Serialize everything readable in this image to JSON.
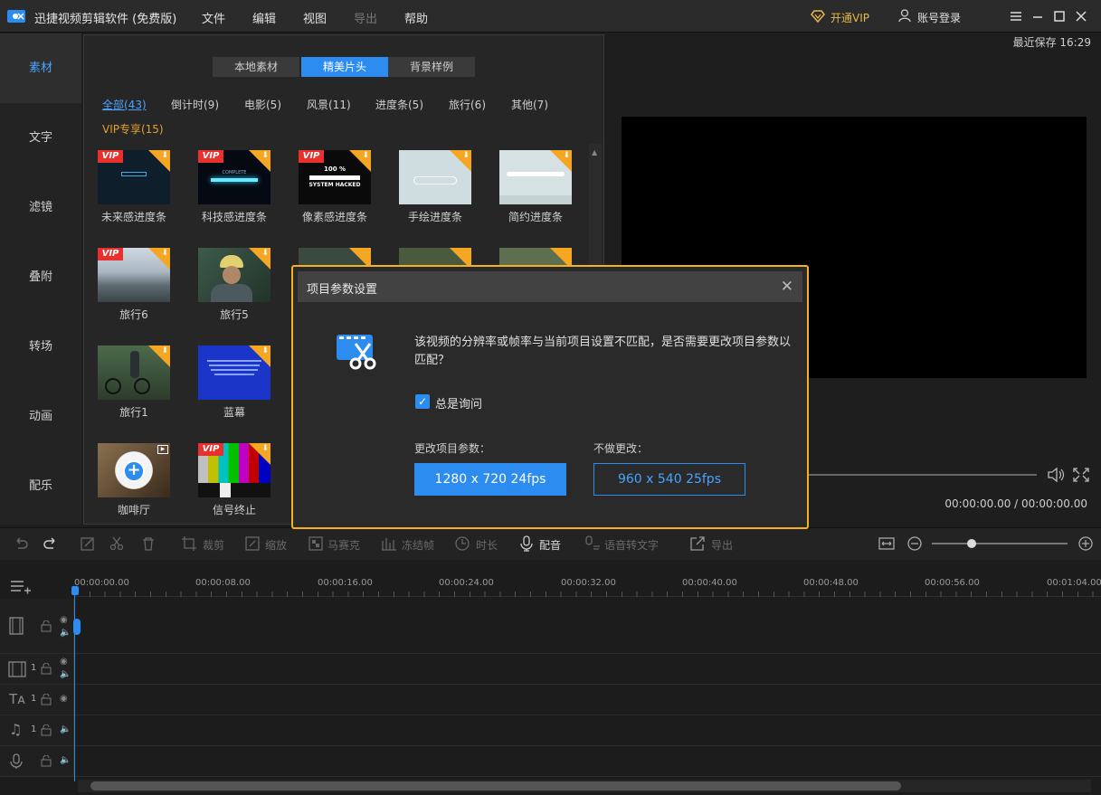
{
  "app": {
    "title": "迅捷视频剪辑软件 (免费版)"
  },
  "menu": {
    "file": "文件",
    "edit": "编辑",
    "view": "视图",
    "export": "导出",
    "help": "帮助"
  },
  "topright": {
    "vip": "开通VIP",
    "login": "账号登录",
    "last_save": "最近保存 16:29"
  },
  "sidebar": {
    "items": [
      "素材",
      "文字",
      "滤镜",
      "叠附",
      "转场",
      "动画",
      "配乐"
    ]
  },
  "panel": {
    "tabs": [
      "本地素材",
      "精美片头",
      "背景样例"
    ],
    "categories": [
      "全部(43)",
      "倒计时(9)",
      "电影(5)",
      "风景(11)",
      "进度条(5)",
      "旅行(6)",
      "其他(7)",
      "VIP专享(15)"
    ],
    "items": [
      {
        "label": "未来感进度条",
        "vip": "VIP"
      },
      {
        "label": "科技感进度条",
        "vip": "VIP"
      },
      {
        "label": "像素感进度条",
        "vip": "VIP"
      },
      {
        "label": "手绘进度条",
        "vip": ""
      },
      {
        "label": "简约进度条",
        "vip": ""
      },
      {
        "label": "旅行6",
        "vip": "VIP"
      },
      {
        "label": "旅行5",
        "vip": ""
      },
      {
        "label": "旅行1",
        "vip": ""
      },
      {
        "label": "蓝幕",
        "vip": ""
      },
      {
        "label": "咖啡厅",
        "vip": ""
      },
      {
        "label": "信号终止",
        "vip": "VIP"
      }
    ],
    "thumb_text": {
      "pixel_pct": "100 %",
      "pixel_hack": "SYSTEM HACKED",
      "complete": "COMPLETE"
    }
  },
  "preview": {
    "time": "00:00:00.00 / 00:00:00.00"
  },
  "toolbar": {
    "crop": "裁剪",
    "zoom": "缩放",
    "mosaic": "马赛克",
    "freeze": "冻结帧",
    "duration": "时长",
    "dub": "配音",
    "speech": "语音转文字",
    "export": "导出"
  },
  "timeline": {
    "ticks": [
      "00:00:00.00",
      "00:00:08.00",
      "00:00:16.00",
      "00:00:24.00",
      "00:00:32.00",
      "00:00:40.00",
      "00:00:48.00",
      "00:00:56.00",
      "00:01:04.00"
    ],
    "track_nums": [
      "1",
      "1",
      "1"
    ]
  },
  "dialog": {
    "title": "项目参数设置",
    "message": "该视频的分辨率或帧率与当前项目设置不匹配，是否需要更改项目参数以匹配？",
    "always_ask": "总是询问",
    "change_label": "更改项目参数：",
    "keep_label": "不做更改：",
    "change_button": "1280 x 720 24fps",
    "keep_button": "960 x 540 25fps"
  }
}
